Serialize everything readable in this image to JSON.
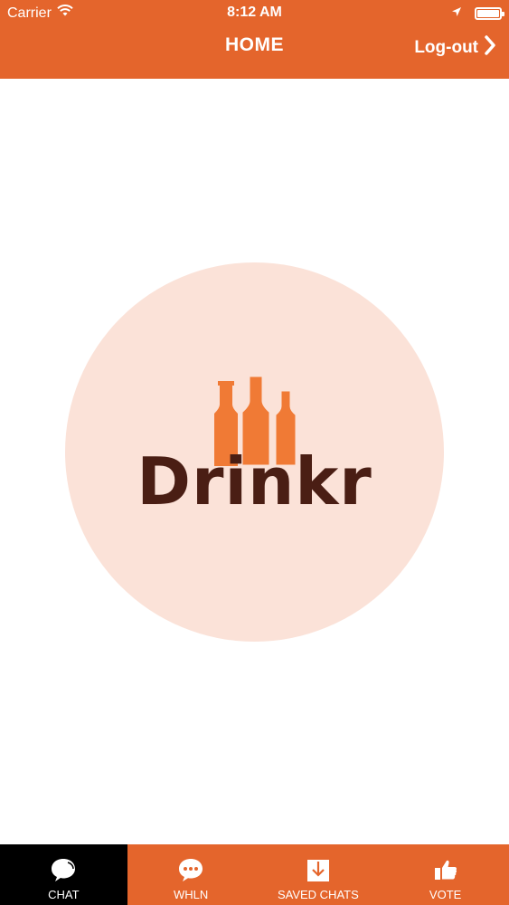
{
  "status_bar": {
    "carrier": "Carrier",
    "time": "8:12 AM"
  },
  "nav": {
    "title": "HOME",
    "logout_label": "Log-out"
  },
  "logo": {
    "text": "Drinkr",
    "circle_color": "#FBE2D8",
    "bottle_color": "#F07A35",
    "text_color": "#4A1E14"
  },
  "tabs": [
    {
      "label": "CHAT",
      "icon": "chat-bubble-icon",
      "active": true
    },
    {
      "label": "WHLN",
      "icon": "speech-dots-icon",
      "active": false
    },
    {
      "label": "SAVED CHATS",
      "icon": "download-box-icon",
      "active": false
    },
    {
      "label": "VOTE",
      "icon": "thumbs-up-icon",
      "active": false
    }
  ],
  "colors": {
    "brand": "#E4652C",
    "active_tab": "#000000"
  }
}
